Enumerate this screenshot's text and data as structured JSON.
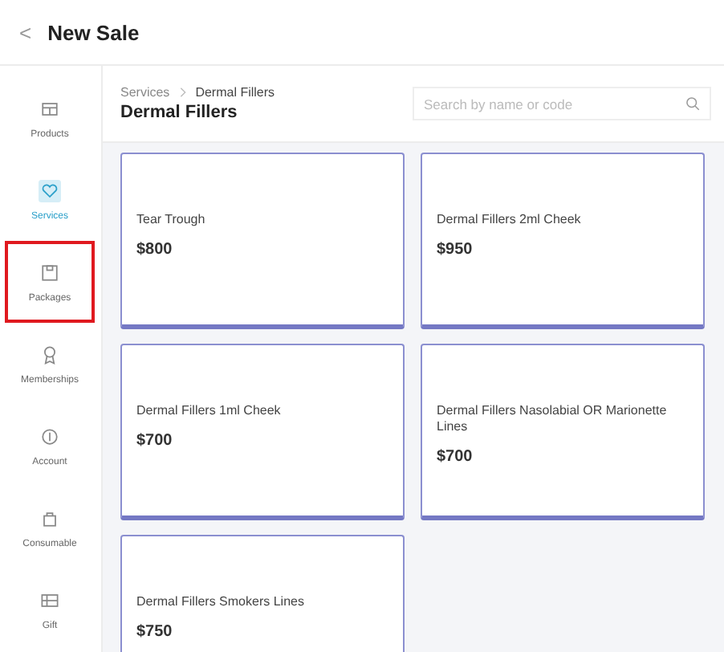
{
  "header": {
    "back": "<",
    "title": "New Sale"
  },
  "sidebar": {
    "items": [
      {
        "label": "Products",
        "kind": "products",
        "selected": false,
        "highlighted": false
      },
      {
        "label": "Services",
        "kind": "services",
        "selected": true,
        "highlighted": false
      },
      {
        "label": "Packages",
        "kind": "packages",
        "selected": false,
        "highlighted": true
      },
      {
        "label": "Memberships",
        "kind": "memberships",
        "selected": false,
        "highlighted": false
      },
      {
        "label": "Account",
        "kind": "account",
        "selected": false,
        "highlighted": false
      },
      {
        "label": "Consumable",
        "kind": "consumable",
        "selected": false,
        "highlighted": false
      },
      {
        "label": "Gift",
        "kind": "gift",
        "selected": false,
        "highlighted": false
      }
    ]
  },
  "breadcrumb": [
    "Services",
    "Dermal Fillers"
  ],
  "page_title": "Dermal Fillers",
  "search": {
    "placeholder": "Search by name or code"
  },
  "cards": [
    {
      "name": "Tear Trough",
      "price": "$800"
    },
    {
      "name": "Dermal Fillers 2ml Cheek",
      "price": "$950"
    },
    {
      "name": "Dermal Fillers 1ml Cheek",
      "price": "$700"
    },
    {
      "name": "Dermal Fillers Nasolabial OR Marionette Lines",
      "price": "$700"
    },
    {
      "name": "Dermal Fillers Smokers Lines",
      "price": "$750"
    }
  ]
}
